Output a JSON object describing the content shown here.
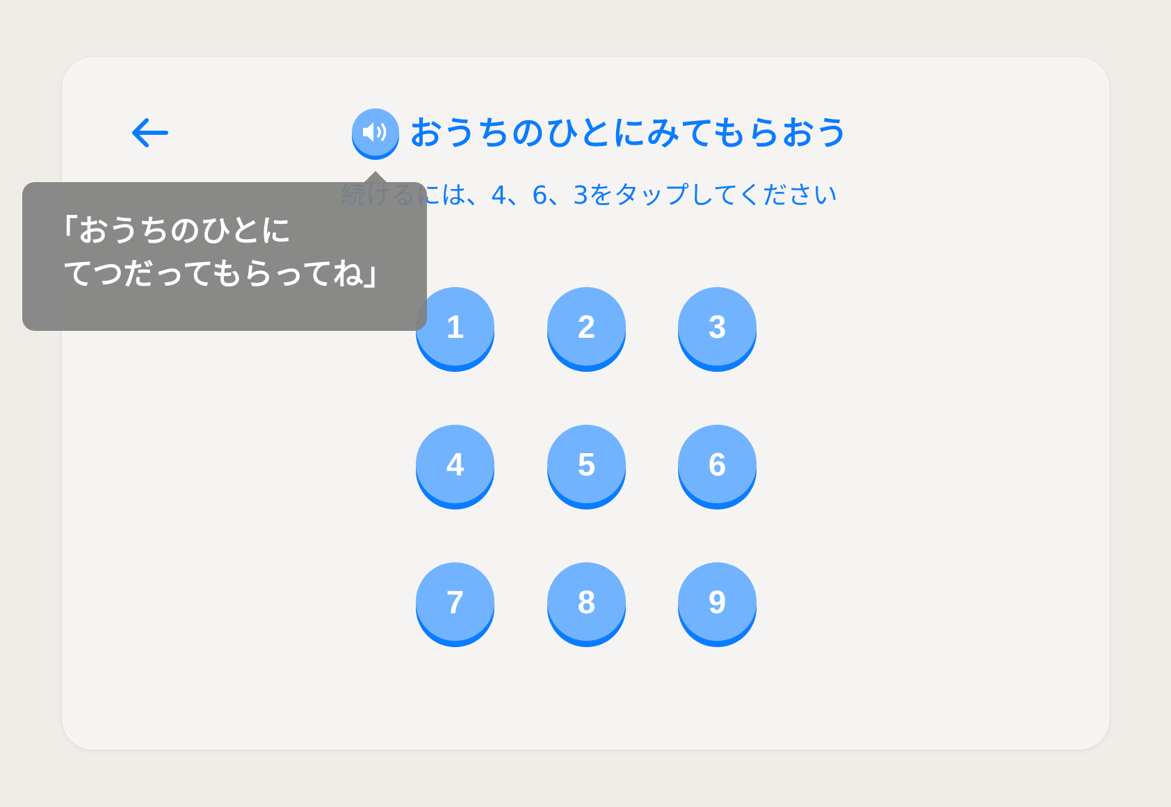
{
  "header": {
    "title": "おうちのひとにみてもらおう",
    "back_icon": "arrow-left-icon",
    "speaker_icon": "speaker-icon"
  },
  "instruction": "続けるには、4、6、3をタップしてください",
  "keypad": {
    "keys": [
      "1",
      "2",
      "3",
      "4",
      "5",
      "6",
      "7",
      "8",
      "9"
    ]
  },
  "tooltip": {
    "line1": "「おうちのひとに",
    "line2": "てつだってもらってね」"
  },
  "colors": {
    "accent": "#0a7cff",
    "key_face": "#72b3ff",
    "tooltip_bg": "#808080",
    "card_bg": "#f6f4f2",
    "page_bg": "#f0ede9"
  }
}
